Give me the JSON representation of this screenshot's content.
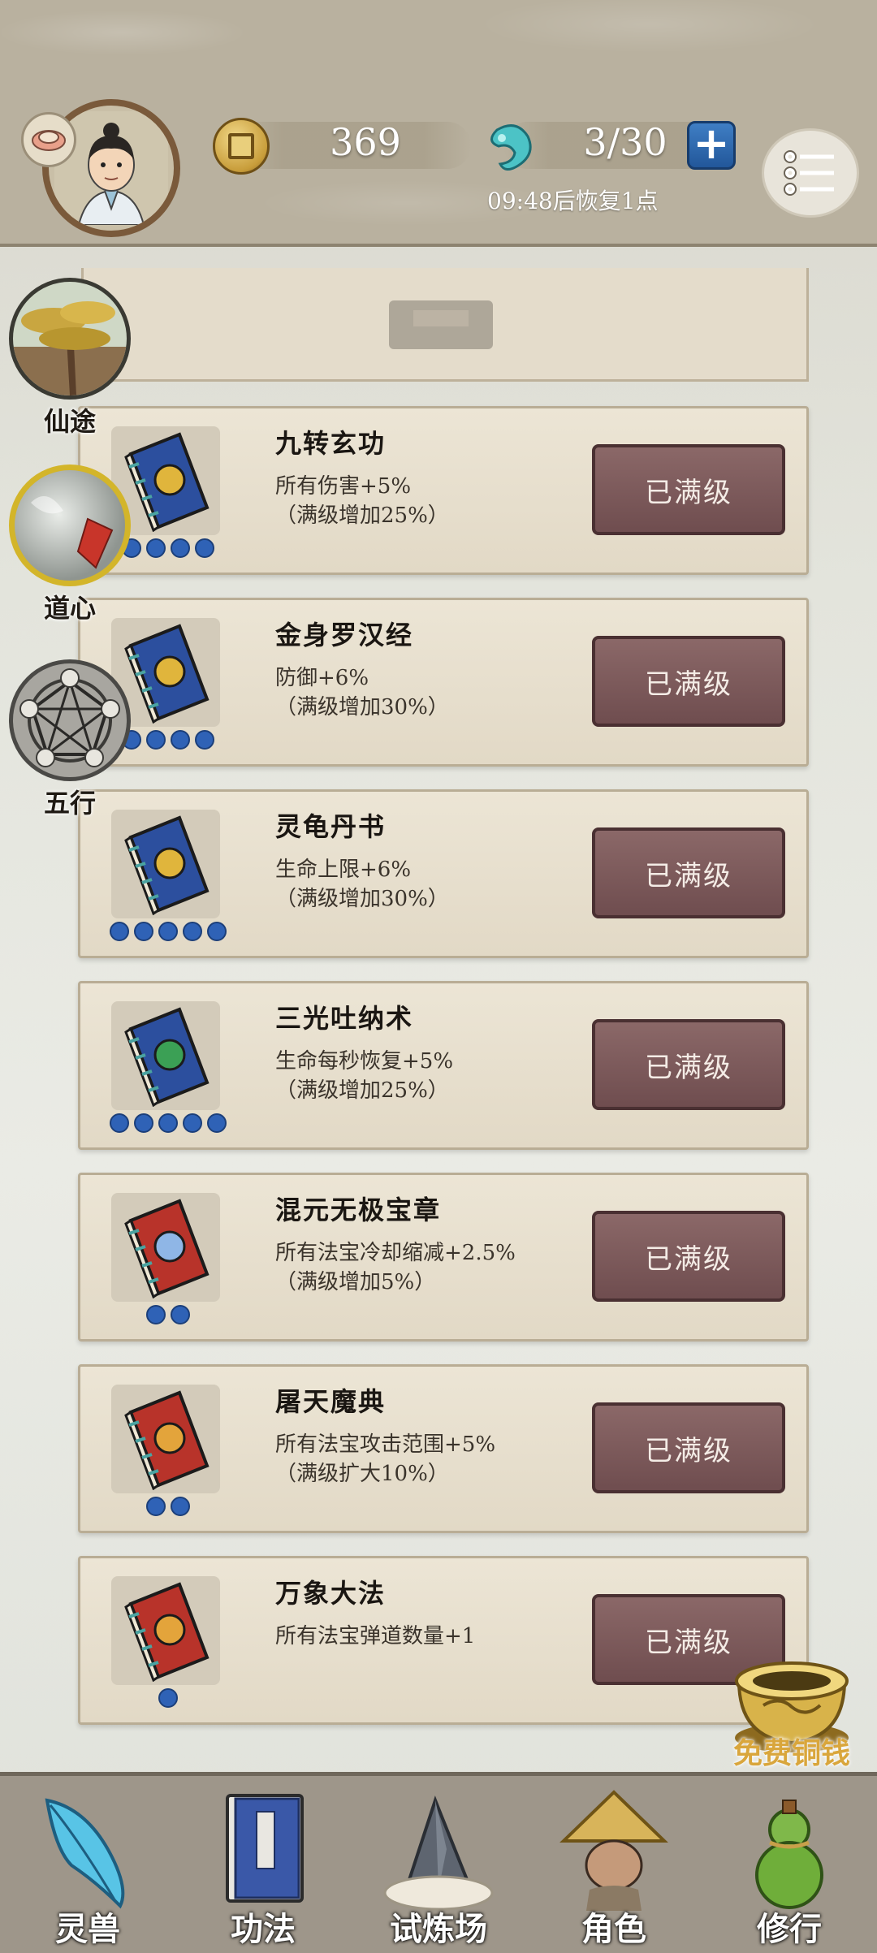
{
  "header": {
    "coins": "369",
    "stamina": "3/30",
    "recover_text": "09:48后恢复1点"
  },
  "side": [
    {
      "label": "仙途",
      "icon": "pine-tree-icon"
    },
    {
      "label": "道心",
      "icon": "mirror-orb-icon"
    },
    {
      "label": "五行",
      "icon": "five-elements-icon"
    }
  ],
  "skills": [
    {
      "name": "九转玄功",
      "line1": "所有伤害+5%",
      "line2": "（满级增加25%）",
      "button": "已满级",
      "dots": 4,
      "book_color": "#2c4f9e",
      "emblem_color": "#e0b53c"
    },
    {
      "name": "金身罗汉经",
      "line1": "防御+6%",
      "line2": "（满级增加30%）",
      "button": "已满级",
      "dots": 4,
      "book_color": "#2c4f9e",
      "emblem_color": "#e0b53c"
    },
    {
      "name": "灵龟丹书",
      "line1": "生命上限+6%",
      "line2": "（满级增加30%）",
      "button": "已满级",
      "dots": 5,
      "book_color": "#2c4f9e",
      "emblem_color": "#e0b53c"
    },
    {
      "name": "三光吐纳术",
      "line1": "生命每秒恢复+5%",
      "line2": "（满级增加25%）",
      "button": "已满级",
      "dots": 5,
      "book_color": "#2c4f9e",
      "emblem_color": "#3ba055"
    },
    {
      "name": "混元无极宝章",
      "line1": "所有法宝冷却缩减+2.5%",
      "line2": "（满级增加5%）",
      "button": "已满级",
      "dots": 2,
      "book_color": "#b8332a",
      "emblem_color": "#8fb6e6"
    },
    {
      "name": "屠天魔典",
      "line1": "所有法宝攻击范围+5%",
      "line2": "（满级扩大10%）",
      "button": "已满级",
      "dots": 2,
      "book_color": "#b8332a",
      "emblem_color": "#e3a43b"
    },
    {
      "name": "万象大法",
      "line1": "所有法宝弹道数量+1",
      "line2": "",
      "button": "已满级",
      "dots": 1,
      "book_color": "#b8332a",
      "emblem_color": "#e3a43b"
    }
  ],
  "free_coin": {
    "label": "免费铜钱"
  },
  "nav": [
    {
      "label": "灵兽",
      "icon": "spirit-feather-icon"
    },
    {
      "label": "功法",
      "icon": "scroll-book-icon"
    },
    {
      "label": "试炼场",
      "icon": "mountain-cloud-icon"
    },
    {
      "label": "角色",
      "icon": "straw-hat-character-icon"
    },
    {
      "label": "修行",
      "icon": "gourd-icon"
    }
  ]
}
